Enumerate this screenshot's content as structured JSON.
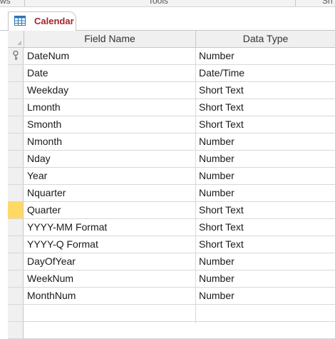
{
  "ribbon": {
    "left_fragment": "ws",
    "center_fragment": "Tools",
    "right_fragment": "Sh"
  },
  "tab": {
    "label": "Calendar",
    "icon": "table-icon"
  },
  "columns": {
    "field_name": "Field Name",
    "data_type": "Data Type"
  },
  "rows": [
    {
      "field": "DateNum",
      "type": "Number",
      "primary_key": true
    },
    {
      "field": "Date",
      "type": "Date/Time"
    },
    {
      "field": "Weekday",
      "type": "Short Text"
    },
    {
      "field": "Lmonth",
      "type": "Short Text"
    },
    {
      "field": "Smonth",
      "type": "Short Text"
    },
    {
      "field": "Nmonth",
      "type": "Number"
    },
    {
      "field": "Nday",
      "type": "Number"
    },
    {
      "field": "Year",
      "type": "Number"
    },
    {
      "field": "Nquarter",
      "type": "Number"
    },
    {
      "field": "Quarter",
      "type": "Short Text",
      "current": true
    },
    {
      "field": "YYYY-MM Format",
      "type": "Short Text"
    },
    {
      "field": "YYYY-Q Format",
      "type": "Short Text"
    },
    {
      "field": "DayOfYear",
      "type": "Number"
    },
    {
      "field": "WeekNum",
      "type": "Number"
    },
    {
      "field": "MonthNum",
      "type": "Number"
    },
    {
      "field": "",
      "type": ""
    },
    {
      "field": "",
      "type": ""
    }
  ],
  "colors": {
    "tab_text": "#a4262c",
    "current_row_selector": "#ffd966",
    "grid_line": "#d8d8d8"
  }
}
